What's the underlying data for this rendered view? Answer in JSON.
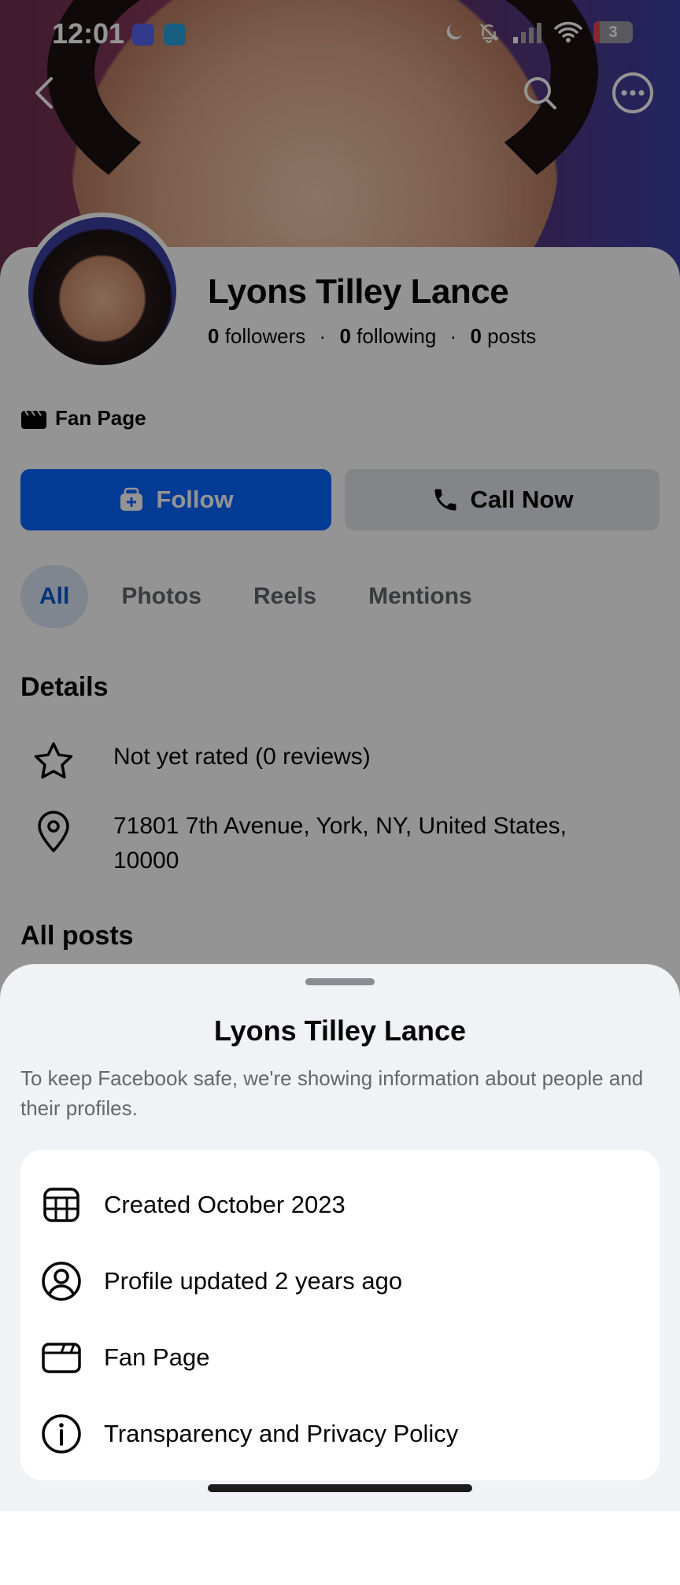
{
  "status_bar": {
    "time": "12:01",
    "battery": "3"
  },
  "profile": {
    "name": "Lyons Tilley Lance",
    "followers_count": "0",
    "followers_label": "followers",
    "following_count": "0",
    "following_label": "following",
    "posts_count": "0",
    "posts_label": "posts",
    "separator": "·",
    "page_type": "Fan Page"
  },
  "actions": {
    "follow_label": "Follow",
    "call_label": "Call Now"
  },
  "tabs": [
    {
      "label": "All",
      "active": true
    },
    {
      "label": "Photos",
      "active": false
    },
    {
      "label": "Reels",
      "active": false
    },
    {
      "label": "Mentions",
      "active": false
    }
  ],
  "details": {
    "title": "Details",
    "rating": "Not yet rated (0 reviews)",
    "address_line1": "71801 7th Avenue, York, NY, United States,",
    "address_line2": "10000"
  },
  "posts_section_title": "All posts",
  "sheet": {
    "title": "Lyons Tilley Lance",
    "description": "To keep Facebook safe, we're showing information about people and their profiles.",
    "items": [
      {
        "icon": "calendar-icon",
        "label": "Created October 2023"
      },
      {
        "icon": "user-circle-icon",
        "label": "Profile updated 2 years ago"
      },
      {
        "icon": "clapperboard-icon",
        "label": "Fan Page"
      },
      {
        "icon": "info-icon",
        "label": "Transparency and Privacy Policy"
      }
    ]
  },
  "colors": {
    "primary": "#0866ff",
    "secondary_button": "#e4e6eb",
    "tab_active_bg": "#dbe7f7",
    "sheet_bg": "#f0f2f5",
    "muted_text": "#65676b"
  }
}
